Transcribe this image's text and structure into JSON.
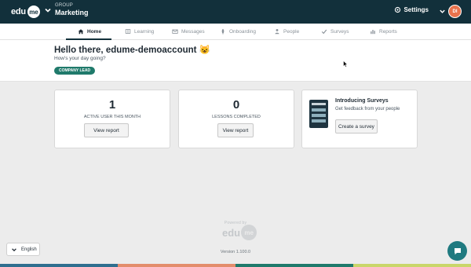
{
  "header": {
    "logo_text": "edu",
    "logo_badge": "me",
    "group_label": "GROUP",
    "group_name": "Marketing",
    "settings_label": "Settings",
    "avatar_initials": "DI"
  },
  "nav": {
    "tabs": [
      {
        "label": "Home",
        "icon": "home-icon",
        "active": true
      },
      {
        "label": "Learning",
        "icon": "book-icon"
      },
      {
        "label": "Messages",
        "icon": "mail-icon"
      },
      {
        "label": "Onboarding",
        "icon": "rocket-icon"
      },
      {
        "label": "People",
        "icon": "person-icon"
      },
      {
        "label": "Surveys",
        "icon": "check-icon"
      },
      {
        "label": "Reports",
        "icon": "bar-chart-icon"
      }
    ]
  },
  "greeting": {
    "title": "Hello there, edume-demoaccount 😺",
    "subtitle": "How's your day going?",
    "role": "COMPANY LEAD"
  },
  "cards": {
    "active_users": {
      "value": "1",
      "label": "ACTIVE USER THIS MONTH",
      "button": "View report"
    },
    "lessons": {
      "value": "0",
      "label": "LESSONS COMPLETED",
      "button": "View report"
    },
    "survey": {
      "title": "Introducing Surveys",
      "subtitle": "Get feedback from your people",
      "button": "Create a survey",
      "icon": "clipboard-icon"
    }
  },
  "footer": {
    "powered_by": "Powered by",
    "logo_text": "edu",
    "logo_badge": "me",
    "version": "Version 1.100.0",
    "language": "English"
  },
  "colors": {
    "topbar": "#12303b",
    "accent": "#1f7a6b",
    "avatar": "#e9734d",
    "chat": "#1f7a80",
    "strip": [
      "#2f6f8f",
      "#e38d6c",
      "#1f7a6b",
      "#c9d66a"
    ]
  }
}
